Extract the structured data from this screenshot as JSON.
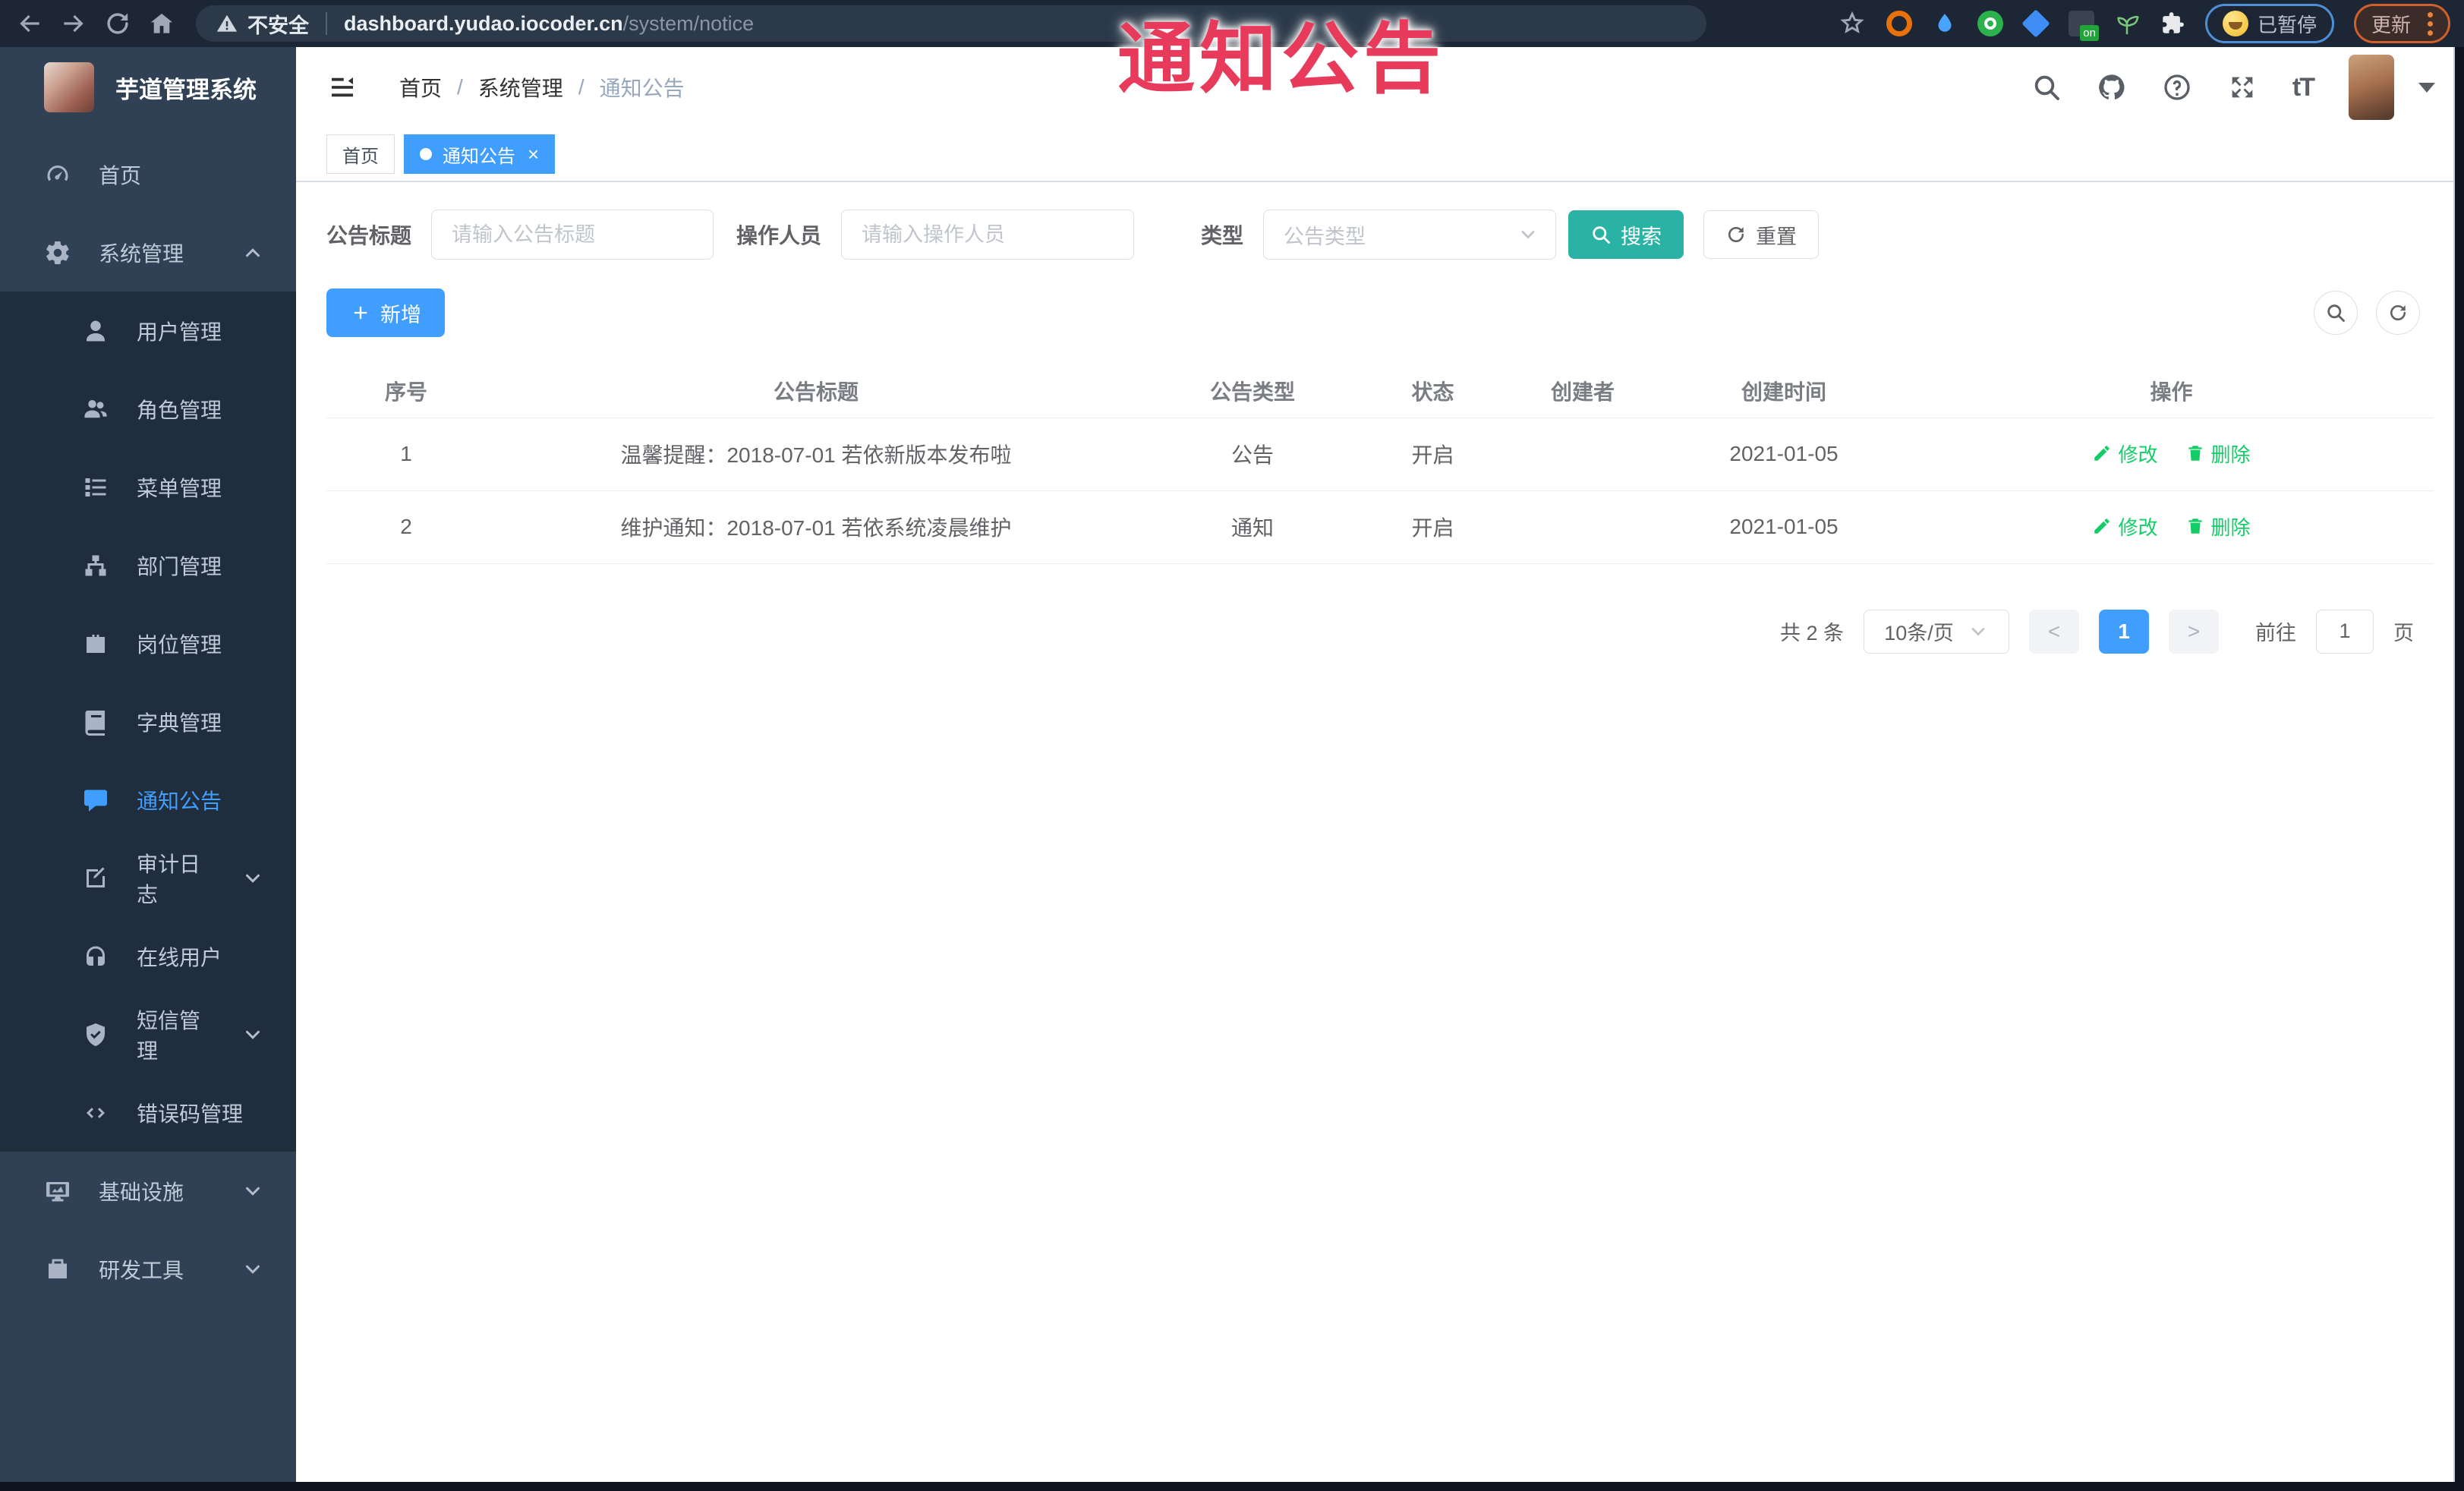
{
  "browser": {
    "security_label": "不安全",
    "url_host": "dashboard.yudao.iocoder.cn",
    "url_path": "/system/notice",
    "extension_badge": "on",
    "paused_label": "已暂停",
    "update_label": "更新"
  },
  "overlay": {
    "text": "通知公告",
    "color": "#e83a5a"
  },
  "sidebar": {
    "title": "芋道管理系统",
    "items": [
      {
        "icon": "dashboard-icon",
        "label": "首页",
        "level": 1
      },
      {
        "icon": "gear-icon",
        "label": "系统管理",
        "level": 1,
        "chevron": "up"
      },
      {
        "icon": "user-icon",
        "label": "用户管理",
        "level": 2
      },
      {
        "icon": "users-icon",
        "label": "角色管理",
        "level": 2
      },
      {
        "icon": "menu-list-icon",
        "label": "菜单管理",
        "level": 2
      },
      {
        "icon": "org-tree-icon",
        "label": "部门管理",
        "level": 2
      },
      {
        "icon": "post-icon",
        "label": "岗位管理",
        "level": 2
      },
      {
        "icon": "dict-icon",
        "label": "字典管理",
        "level": 2
      },
      {
        "icon": "notice-icon",
        "label": "通知公告",
        "level": 2,
        "active": true
      },
      {
        "icon": "audit-icon",
        "label": "审计日志",
        "level": 2,
        "chevron": "down"
      },
      {
        "icon": "online-user-icon",
        "label": "在线用户",
        "level": 2
      },
      {
        "icon": "sms-icon",
        "label": "短信管理",
        "level": 2,
        "chevron": "down"
      },
      {
        "icon": "error-code-icon",
        "label": "错误码管理",
        "level": 2
      },
      {
        "icon": "infra-icon",
        "label": "基础设施",
        "level": 1,
        "chevron": "down"
      },
      {
        "icon": "devtools-icon",
        "label": "研发工具",
        "level": 1,
        "chevron": "down"
      }
    ]
  },
  "header": {
    "breadcrumb": [
      "首页",
      "系统管理",
      "通知公告"
    ]
  },
  "tabs": [
    {
      "label": "首页",
      "active": false,
      "closable": false
    },
    {
      "label": "通知公告",
      "active": true,
      "closable": true
    }
  ],
  "filters": {
    "title": {
      "label": "公告标题",
      "placeholder": "请输入公告标题",
      "value": ""
    },
    "operator": {
      "label": "操作人员",
      "placeholder": "请输入操作人员",
      "value": ""
    },
    "type": {
      "label": "类型",
      "placeholder": "公告类型",
      "value": ""
    },
    "search_label": "搜索",
    "reset_label": "重置"
  },
  "toolbar": {
    "add_label": "新增"
  },
  "table": {
    "headers": [
      "序号",
      "公告标题",
      "公告类型",
      "状态",
      "创建者",
      "创建时间",
      "操作"
    ],
    "rows": [
      {
        "no": "1",
        "title": "温馨提醒：2018-07-01 若依新版本发布啦",
        "type": "公告",
        "status": "开启",
        "creator": "",
        "created_at": "2021-01-05"
      },
      {
        "no": "2",
        "title": "维护通知：2018-07-01 若依系统凌晨维护",
        "type": "通知",
        "status": "开启",
        "creator": "",
        "created_at": "2021-01-05"
      }
    ],
    "edit_label": "修改",
    "delete_label": "删除"
  },
  "pagination": {
    "total_text": "共 2 条",
    "page_size": "10条/页",
    "current_page": "1",
    "goto_prefix": "前往",
    "goto_value": "1",
    "goto_suffix": "页"
  },
  "colors": {
    "accent_blue": "#409eff",
    "search_teal": "#2ab3a5",
    "action_green": "#13ce66",
    "overlay_red": "#e83a5a",
    "sidebar_bg": "#304156",
    "submenu_bg": "#1f2d3d",
    "browser_bar": "#1c2634"
  }
}
